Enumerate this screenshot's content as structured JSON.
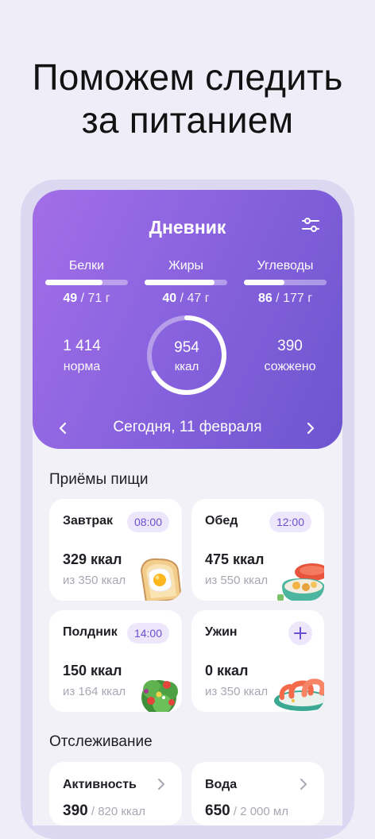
{
  "hero": {
    "line1": "Поможем следить",
    "line2": "за питанием"
  },
  "diary": {
    "title": "Дневник",
    "macros": [
      {
        "label": "Белки",
        "value": "49",
        "target": " / 71 г",
        "progress": 0.69
      },
      {
        "label": "Жиры",
        "value": "40",
        "target": " / 47 г",
        "progress": 0.85
      },
      {
        "label": "Углеводы",
        "value": "86",
        "target": " / 177 г",
        "progress": 0.49
      }
    ],
    "norm": {
      "value": "1 414",
      "label": "норма"
    },
    "ring": {
      "value": "954",
      "unit": "ккал",
      "progress": 0.67
    },
    "burned": {
      "value": "390",
      "label": "сожжено"
    },
    "date": "Сегодня, 11 февраля"
  },
  "meals_section": {
    "title": "Приёмы пищи"
  },
  "meals": [
    {
      "name": "Завтрак",
      "time": "08:00",
      "kcal": "329 ккал",
      "of": "из 350 ккал",
      "icon": "toast-egg-icon"
    },
    {
      "name": "Обед",
      "time": "12:00",
      "kcal": "475 ккал",
      "of": "из 550 ккал",
      "icon": "lunch-bowl-icon"
    },
    {
      "name": "Полдник",
      "time": "14:00",
      "kcal": "150 ккал",
      "of": "из 164 ккал",
      "icon": "salad-icon"
    },
    {
      "name": "Ужин",
      "time": "",
      "kcal": "0 ккал",
      "of": "из 350 ккал",
      "icon": "shrimp-plate-icon"
    }
  ],
  "tracking_section": {
    "title": "Отслеживание"
  },
  "tracking": [
    {
      "name": "Активность",
      "value": "390",
      "rest": " / 820 ккал"
    },
    {
      "name": "Вода",
      "value": "650",
      "rest": " / 2 000 мл"
    }
  ],
  "colors": {
    "accent": "#6b4fd0",
    "gradient_start": "#a36ee7",
    "gradient_end": "#6d55cf",
    "background": "#efedf8"
  }
}
